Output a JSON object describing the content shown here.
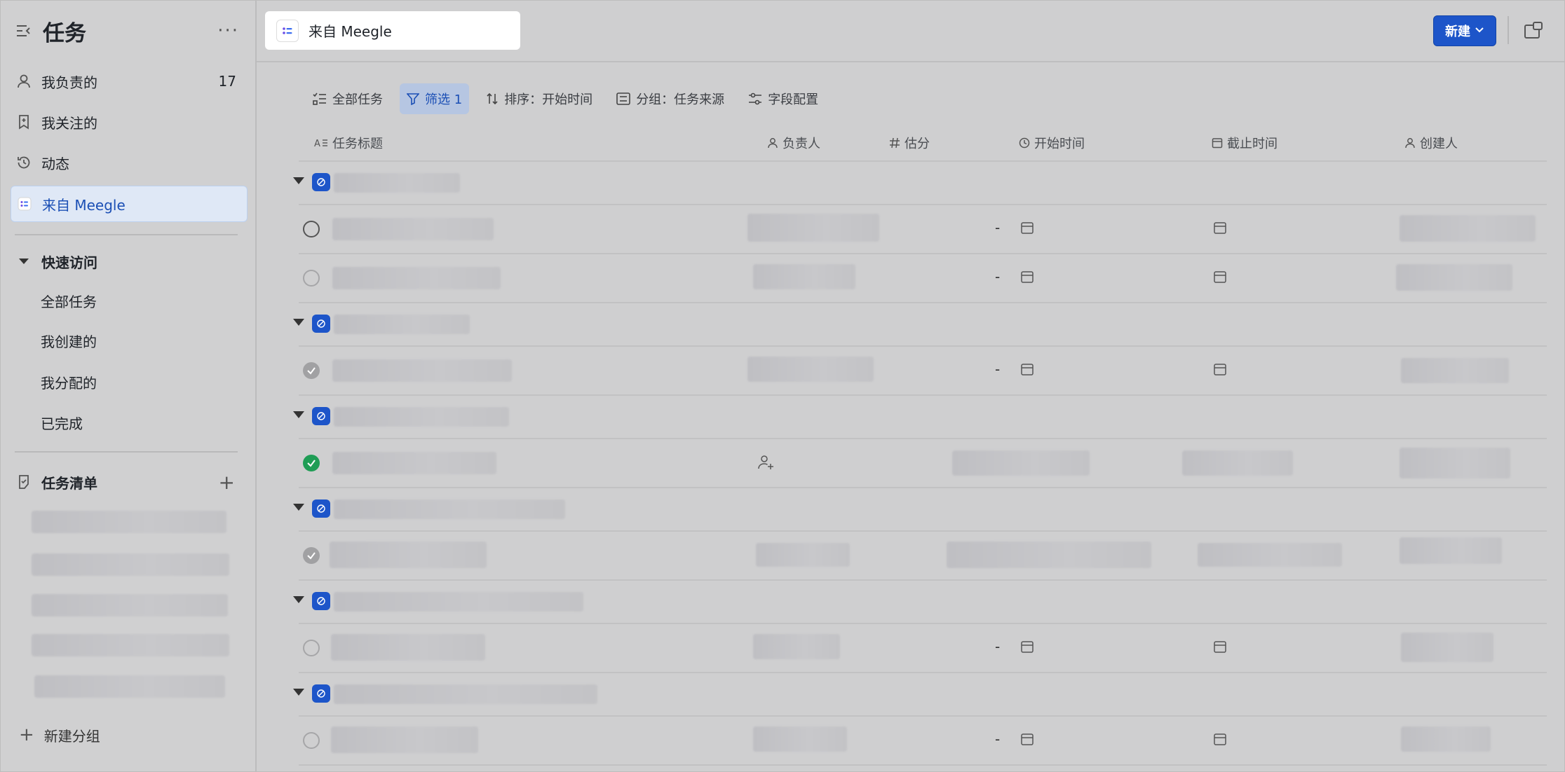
{
  "sidebar": {
    "title": "任务",
    "more_label": "···",
    "nav": [
      {
        "label": "我负责的",
        "count": "17",
        "icon": "person-icon"
      },
      {
        "label": "我关注的",
        "icon": "bookmark-icon"
      },
      {
        "label": "动态",
        "icon": "history-icon"
      },
      {
        "label": "来自 Meegle",
        "icon": "meegle-icon",
        "active": true
      }
    ],
    "quick_access": {
      "label": "快速访问",
      "items": [
        "全部任务",
        "我创建的",
        "我分配的",
        "已完成"
      ]
    },
    "task_lists": {
      "label": "任务清单",
      "add_icon": "plus-icon"
    },
    "new_group_label": "新建分组"
  },
  "topbar": {
    "tab_label": "来自 Meegle",
    "new_button": "新建"
  },
  "toolbar": {
    "all_tasks": "全部任务",
    "filter": "筛选 1",
    "sort": "排序：开始时间",
    "group": "分组：任务来源",
    "fields": "字段配置"
  },
  "table": {
    "columns": [
      "任务标题",
      "负责人",
      "估分",
      "开始时间",
      "截止时间",
      "创建人"
    ]
  },
  "rows": {
    "dash": "-"
  },
  "colors": {
    "accent": "#1d55c9",
    "done_green": "#1f9d55"
  }
}
